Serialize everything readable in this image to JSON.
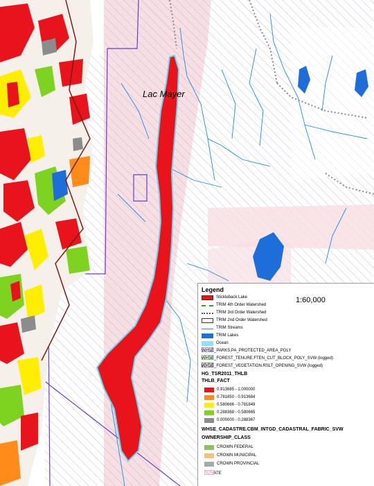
{
  "map": {
    "lake_label": "Lac Mayer",
    "colors": {
      "background": "#ffffff",
      "private": "#f8dfe4",
      "lake_red": "#e8131b",
      "lake_outline": "#68d8f0",
      "stream": "#1a8de0",
      "lake_blue": "#1d6ed8",
      "protected_area": "#6a3cc8",
      "thlb_high": "#e8131b",
      "thlb_2": "#ff8c1a",
      "thlb_3": "#ffee00",
      "thlb_4": "#7ed321",
      "thlb_5": "#8c8c8c"
    }
  },
  "legend": {
    "title": "Legend",
    "scale": "1:60,000",
    "items": [
      {
        "label": "Stickleback Lake",
        "icon": "red-polygon-swatch"
      },
      {
        "label": "TRIM 4th Order Watershed",
        "icon": "green-dashed-line-swatch"
      },
      {
        "label": "TRIM 3rd Order Watershed",
        "icon": "gray-dotted-line-swatch"
      },
      {
        "label": "TRIM 2nd Order Watershed",
        "icon": "brown-outline-swatch"
      },
      {
        "label": "TRIM Streams",
        "icon": "blue-line-swatch"
      },
      {
        "label": "TRIM Lakes",
        "icon": "blue-fill-swatch"
      },
      {
        "label": "Ocean",
        "icon": "cyan-fill-swatch"
      },
      {
        "label": "WHSE_PARKS.PA_PROTECTED_AREA_POLY",
        "icon": "purple-hatch-swatch"
      },
      {
        "label": "WHSE_FOREST_TENURE.FTEN_CUT_BLOCK_POLY_SVW (logged)",
        "icon": "green-hatch-swatch"
      },
      {
        "label": "WHSE_FOREST_VEGETATION.RSLT_OPENING_SVW (logged)",
        "icon": "black-hatch-swatch"
      }
    ],
    "group1": "HG_TSR2011_THLB",
    "field1": "THLB_FACT",
    "thlb_classes": [
      {
        "label": "0.913685 - 1.000000",
        "color": "#e8131b"
      },
      {
        "label": "0.781850 - 0.913684",
        "color": "#ff8c1a"
      },
      {
        "label": "0.580666 - 0.781849",
        "color": "#ffee00"
      },
      {
        "label": "0.288368 - 0.580665",
        "color": "#7ed321"
      },
      {
        "label": "0.000000 - 0.288367",
        "color": "#8c8c8c"
      }
    ],
    "group2": "WHSE_CADASTRE.CBM_INTGD_CADASTRAL_FABRIC_SVW",
    "field2": "OWNERSHIP_CLASS",
    "ownership_classes": [
      {
        "label": "CROWN FEDERAL",
        "color": "#8cc063"
      },
      {
        "label": "CROWN MUNICIPAL",
        "color": "#f2c27a"
      },
      {
        "label": "CROWN PROVINCIAL",
        "color": "#a8a8a8"
      },
      {
        "label": "PRIVATE",
        "color": "#f8dfe4"
      }
    ]
  }
}
